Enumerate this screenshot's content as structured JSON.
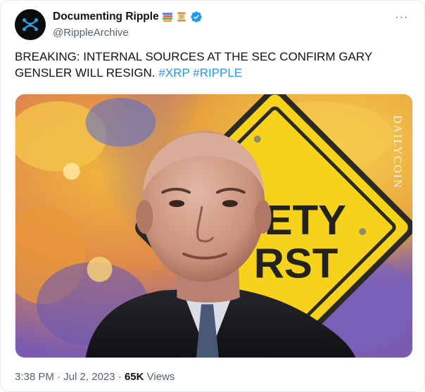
{
  "tweet": {
    "display_name": "Documenting Ripple",
    "name_emojis": [
      "books-emoji",
      "scroll-emoji"
    ],
    "verified": true,
    "handle": "@RippleArchive",
    "more_label": "···",
    "text_main": "BREAKING: INTERNAL SOURCES AT THE SEC CONFIRM GARY GENSLER WILL RESIGN.",
    "hashtags": [
      "#XRP",
      "#RIPPLE"
    ],
    "media": {
      "sign_text_line1": "ETY",
      "sign_text_line2": "RST",
      "watermark": "DAILYCOIN"
    },
    "meta": {
      "time": "3:38 PM",
      "separator": "·",
      "date": "Jul 2, 2023",
      "views_count": "65K",
      "views_label": "Views"
    }
  },
  "colors": {
    "link": "#1d9bf0",
    "verified": "#1d9bf0",
    "secondary_text": "#536471",
    "primary_text": "#0f1419"
  },
  "icons": {
    "avatar": "ripple-logo-icon",
    "verified": "verified-badge-icon",
    "more": "more-horizontal-icon"
  }
}
